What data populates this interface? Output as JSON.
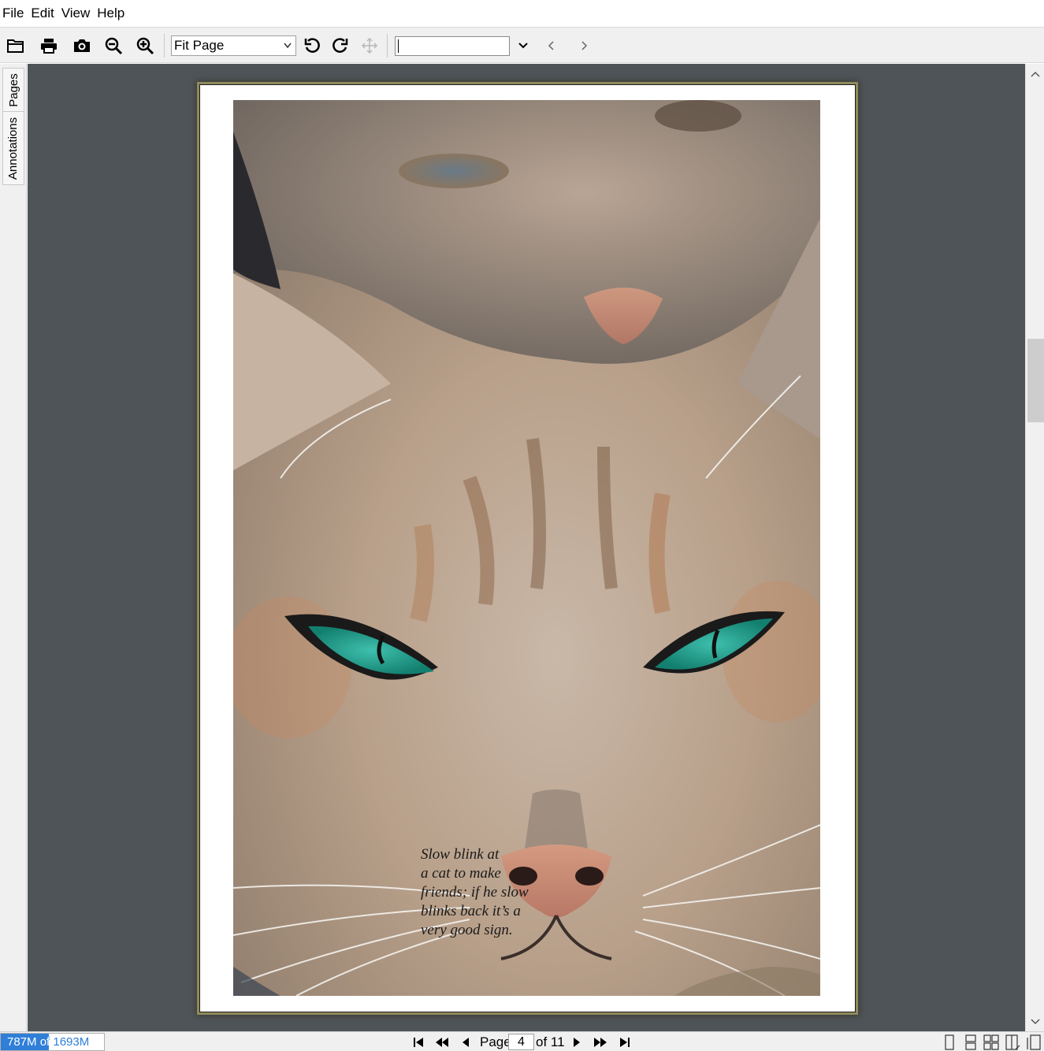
{
  "menubar": {
    "items": [
      "File",
      "Edit",
      "View",
      "Help"
    ]
  },
  "toolbar": {
    "buttons": [
      {
        "name": "open-folder-icon",
        "tooltip": "Open"
      },
      {
        "name": "print-icon",
        "tooltip": "Print"
      },
      {
        "name": "camera-icon",
        "tooltip": "Snapshot"
      },
      {
        "name": "zoom-out-icon",
        "tooltip": "Zoom out"
      },
      {
        "name": "zoom-in-icon",
        "tooltip": "Zoom in"
      },
      {
        "name": "rotate-left-icon",
        "tooltip": "Rotate left"
      },
      {
        "name": "rotate-right-icon",
        "tooltip": "Rotate right"
      },
      {
        "name": "pan-move-icon",
        "tooltip": "Pan"
      }
    ],
    "zoom": {
      "selected": "Fit Page"
    },
    "search": {
      "value": ""
    }
  },
  "sidetabs": {
    "pages": "Pages",
    "annotations": "Annotations"
  },
  "document": {
    "caption_lines": [
      "Slow blink at",
      "a cat to make",
      "friends; if he slow",
      "blinks back it’s a",
      "very good sign."
    ]
  },
  "statusbar": {
    "memory_text": "787M of 1693M",
    "memory_used_fraction": 0.465,
    "page_label": "Page",
    "current_page": "4",
    "total_pages_text": "of 11"
  },
  "colors": {
    "view_background": "#4f5459",
    "toolbar_background": "#f0f0f0",
    "memory_bar": "#2f7fd8",
    "page_glow": "#8f8a5c"
  }
}
